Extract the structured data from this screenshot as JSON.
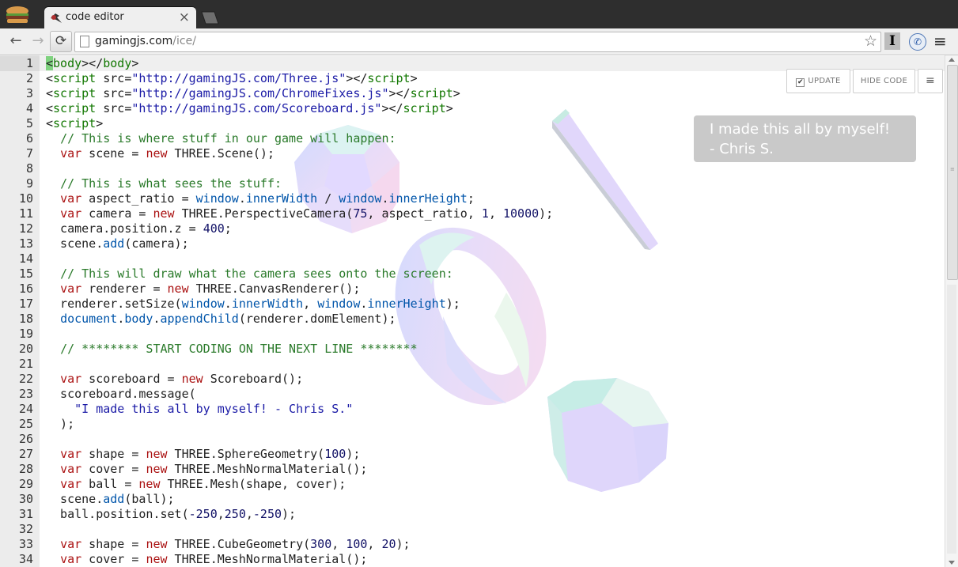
{
  "browser": {
    "tab_title": "code editor",
    "tab_close": "×",
    "url_host": "gamingjs.com",
    "url_path": "/ice/",
    "back": "←",
    "forward": "→",
    "reload": "⟳",
    "star": "☆",
    "ext_i": "I",
    "ext_phone": "✆",
    "menu": "≡"
  },
  "icons": [
    "app-icon",
    "tab-favicon-icon",
    "page-icon",
    "star-icon",
    "menu-icon",
    "reload-icon",
    "back-icon",
    "forward-icon"
  ],
  "editor": {
    "line_numbers": [
      "1",
      "2",
      "3",
      "4",
      "5",
      "6",
      "7",
      "8",
      "9",
      "10",
      "11",
      "12",
      "13",
      "14",
      "15",
      "16",
      "17",
      "18",
      "19",
      "20",
      "21",
      "22",
      "23",
      "24",
      "25",
      "26",
      "27",
      "28",
      "29",
      "30",
      "31",
      "32",
      "33",
      "34"
    ]
  },
  "controls": {
    "update_label": "UPDATE",
    "update_checked": "✔",
    "hide_code_label": "HIDE CODE",
    "hamburger": "≡"
  },
  "scoreboard": {
    "message": "I made this all by myself!\n- Chris S."
  },
  "scrollbar": {
    "grip": "≡"
  },
  "colors": {
    "title_bar": "#2e2e2e",
    "gutter": "#ececec",
    "scoreboard_bg": "#c9c9c9",
    "keyword": "#aa1111",
    "comment": "#2a7a2a"
  }
}
